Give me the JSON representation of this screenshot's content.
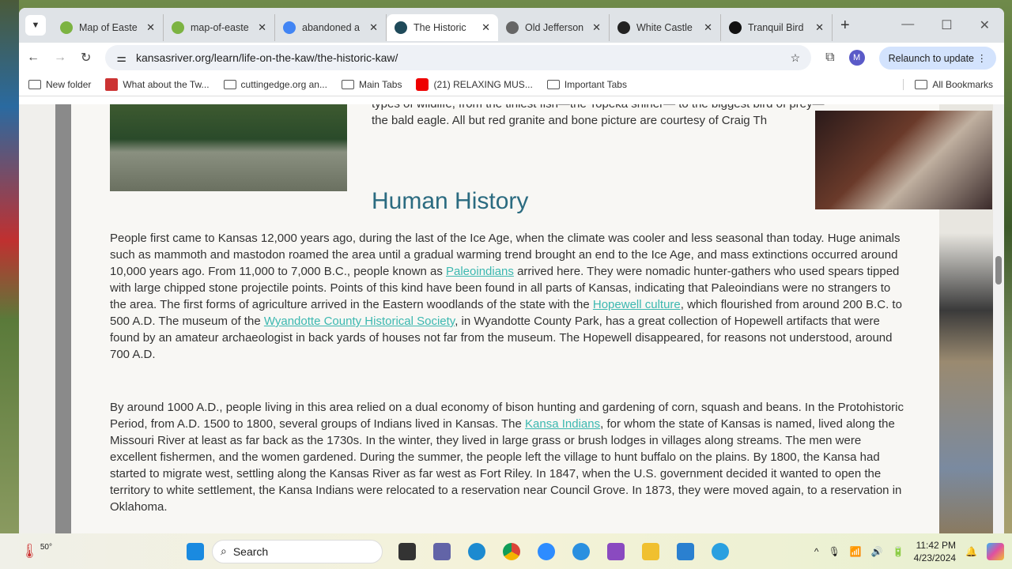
{
  "browser": {
    "tabs": [
      {
        "title": "Map of Easte",
        "icon": "globe-green-icon",
        "color": "#7cb342"
      },
      {
        "title": "map-of-easte",
        "icon": "globe-green-icon",
        "color": "#7cb342"
      },
      {
        "title": "abandoned a",
        "icon": "google-icon",
        "color": "#4285f4"
      },
      {
        "title": "The Historic",
        "icon": "kansas-river-icon",
        "color": "#1f4a5a",
        "active": true
      },
      {
        "title": "Old Jefferson",
        "icon": "globe-icon",
        "color": "#666666"
      },
      {
        "title": "White Castle",
        "icon": "an-logo-icon",
        "color": "#222222"
      },
      {
        "title": "Tranquil Bird",
        "icon": "music-icon",
        "color": "#111111"
      }
    ],
    "url": "kansasriver.org/learn/life-on-the-kaw/the-historic-kaw/",
    "profile_initial": "M",
    "relaunch": "Relaunch to update",
    "bookmarks": [
      "New folder",
      "What about the Tw...",
      "cuttingedge.org an...",
      "Main Tabs",
      "(21) RELAXING MUS...",
      "Important Tabs"
    ],
    "all_bookmarks": "All Bookmarks"
  },
  "page": {
    "top_text_1": "types of wildlife, from the tiniest fish—the Topeka shiner— to the biggest bird of prey—",
    "top_text_2": "the bald eagle. All but red granite and bone picture are courtesy of Craig Th",
    "heading": "Human History",
    "p1": [
      "People first came to Kansas 12,000 years ago, during the last of the Ice Age, when the climate was cooler and less seasonal than today. Huge animals such as mammoth and mastodon roamed the area until a gradual warming trend brought an end to the Ice Age, and mass extinctions occurred around 10,000 years ago. From 11,000 to 7,000 B.C., people known as ",
      "Paleoindians",
      " arrived here. They were nomadic hunter-gathers who used spears tipped with large chipped stone projectile points. Points of this kind have been found in all parts of Kansas, indicating that Paleoindians were no strangers to the area. The first forms of agriculture arrived in the Eastern woodlands of the state with the ",
      "Hopewell culture",
      ", which flourished from around 200 B.C. to 500 A.D. The museum of the ",
      "Wyandotte County Historical Society",
      ", in Wyandotte County Park, has a great collection of Hopewell artifacts that were found by an amateur archaeologist in back yards of houses not far from the museum. The Hopewell disappeared, for reasons not understood, around 700 A.D."
    ],
    "p2": [
      "By around 1000 A.D., people living in this area relied on a dual economy of bison hunting and gardening of corn, squash and beans. In the Protohistoric Period, from A.D. 1500 to 1800, several groups of Indians lived in Kansas. The ",
      "Kansa Indians",
      ", for whom the state of Kansas is named, lived along the Missouri River at least as far back as the 1730s. In the winter, they lived in large grass or brush lodges in villages along streams. The men were excellent fishermen, and the women gardened. During the summer, the people left the village to hunt buffalo on the plains. By 1800, the Kansa had started to migrate west, settling along the Kansas River as far west as Fort Riley. In 1847, when the U.S. government decided it wanted to open the territory to white settlement, the Kansa Indians were relocated to a reservation near Council Grove. In 1873, they were moved again, to a reservation in Oklahoma."
    ]
  },
  "taskbar": {
    "weather": "50°",
    "search": "Search",
    "time": "11:42 PM",
    "date": "4/23/2024"
  }
}
